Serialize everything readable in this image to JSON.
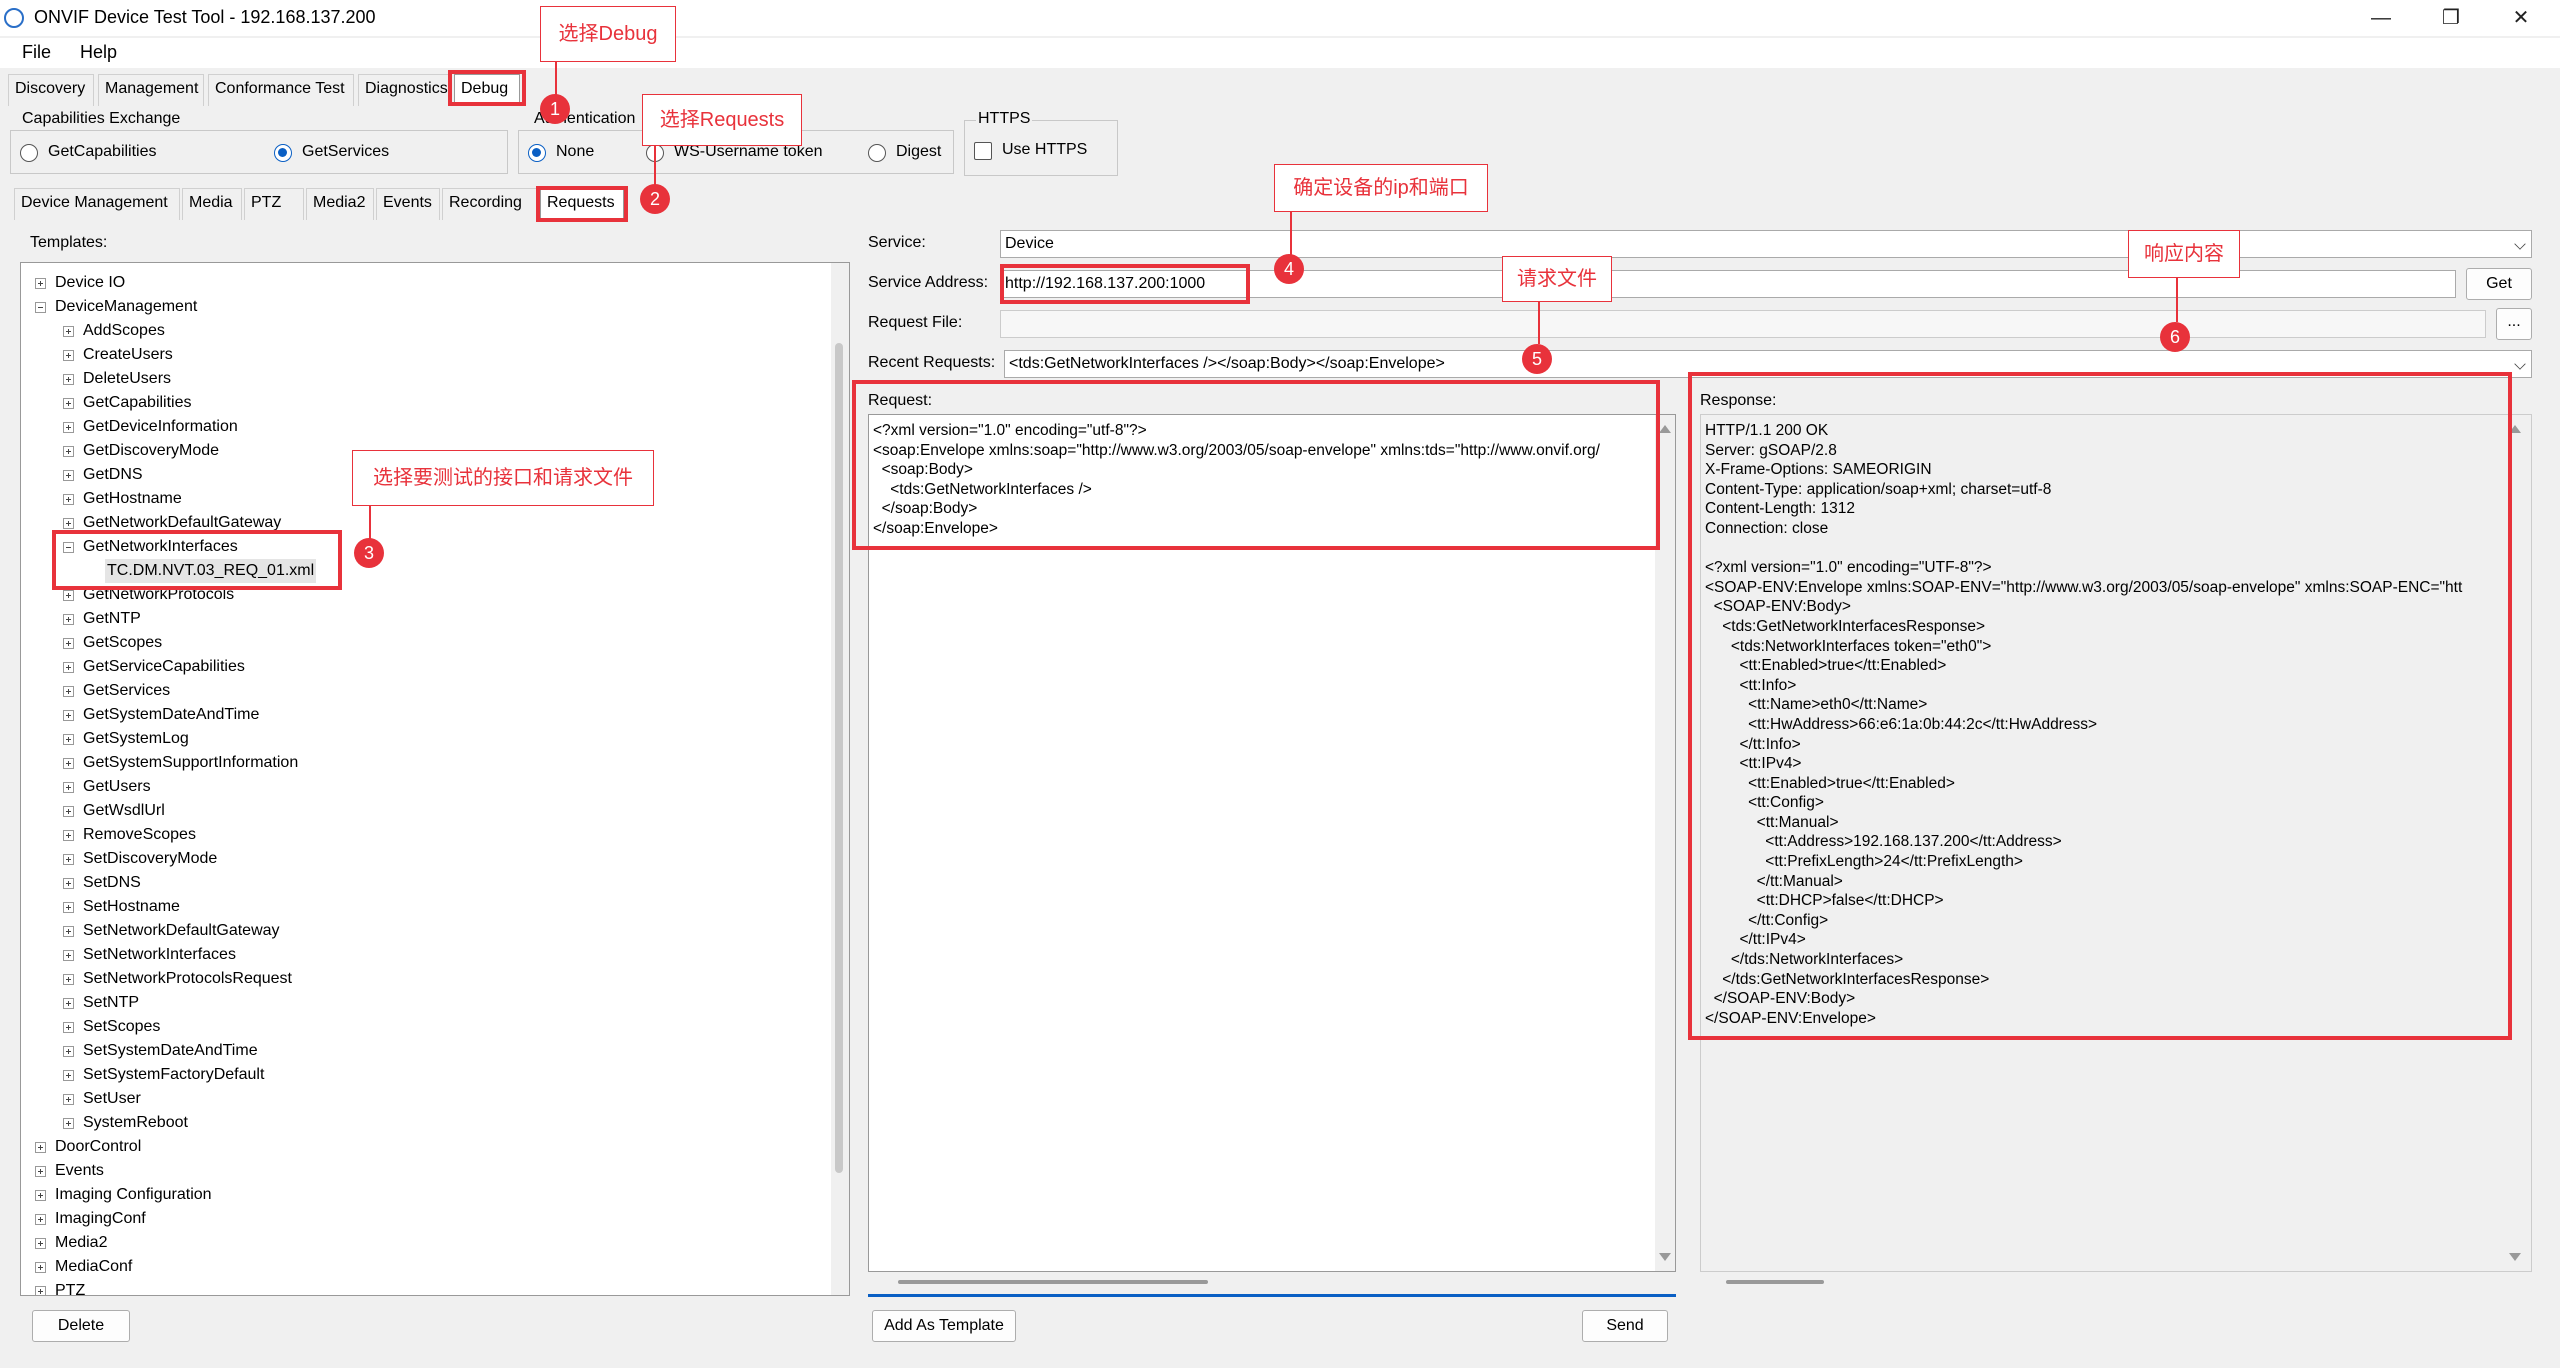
{
  "window": {
    "title": "ONVIF Device Test Tool - 192.168.137.200"
  },
  "menu": {
    "file": "File",
    "help": "Help"
  },
  "main_tabs": [
    "Discovery",
    "Management",
    "Conformance Test",
    "Diagnostics",
    "Debug"
  ],
  "capabilities": {
    "title": "Capabilities Exchange",
    "options": [
      "GetCapabilities",
      "GetServices"
    ],
    "selected": "GetServices"
  },
  "authentication": {
    "title": "Authentication",
    "options": [
      "None",
      "WS-Username token",
      "Digest"
    ],
    "selected": "None"
  },
  "https": {
    "title": "HTTPS",
    "checkbox_label": "Use HTTPS",
    "checked": false
  },
  "sub_tabs": [
    "Device Management",
    "Media",
    "PTZ",
    "Media2",
    "Events",
    "Recording",
    "Requests"
  ],
  "templates": {
    "label": "Templates:",
    "tree": [
      {
        "label": "Device IO",
        "level": 0,
        "state": "closed"
      },
      {
        "label": "DeviceManagement",
        "level": 0,
        "state": "open"
      },
      {
        "label": "AddScopes",
        "level": 1,
        "state": "closed"
      },
      {
        "label": "CreateUsers",
        "level": 1,
        "state": "closed"
      },
      {
        "label": "DeleteUsers",
        "level": 1,
        "state": "closed"
      },
      {
        "label": "GetCapabilities",
        "level": 1,
        "state": "closed"
      },
      {
        "label": "GetDeviceInformation",
        "level": 1,
        "state": "closed"
      },
      {
        "label": "GetDiscoveryMode",
        "level": 1,
        "state": "closed"
      },
      {
        "label": "GetDNS",
        "level": 1,
        "state": "closed"
      },
      {
        "label": "GetHostname",
        "level": 1,
        "state": "closed"
      },
      {
        "label": "GetNetworkDefaultGateway",
        "level": 1,
        "state": "closed"
      },
      {
        "label": "GetNetworkInterfaces",
        "level": 1,
        "state": "open"
      },
      {
        "label": "TC.DM.NVT.03_REQ_01.xml",
        "level": 2,
        "state": "leaf",
        "selected": true
      },
      {
        "label": "GetNetworkProtocols",
        "level": 1,
        "state": "closed"
      },
      {
        "label": "GetNTP",
        "level": 1,
        "state": "closed"
      },
      {
        "label": "GetScopes",
        "level": 1,
        "state": "closed"
      },
      {
        "label": "GetServiceCapabilities",
        "level": 1,
        "state": "closed"
      },
      {
        "label": "GetServices",
        "level": 1,
        "state": "closed"
      },
      {
        "label": "GetSystemDateAndTime",
        "level": 1,
        "state": "closed"
      },
      {
        "label": "GetSystemLog",
        "level": 1,
        "state": "closed"
      },
      {
        "label": "GetSystemSupportInformation",
        "level": 1,
        "state": "closed"
      },
      {
        "label": "GetUsers",
        "level": 1,
        "state": "closed"
      },
      {
        "label": "GetWsdlUrl",
        "level": 1,
        "state": "closed"
      },
      {
        "label": "RemoveScopes",
        "level": 1,
        "state": "closed"
      },
      {
        "label": "SetDiscoveryMode",
        "level": 1,
        "state": "closed"
      },
      {
        "label": "SetDNS",
        "level": 1,
        "state": "closed"
      },
      {
        "label": "SetHostname",
        "level": 1,
        "state": "closed"
      },
      {
        "label": "SetNetworkDefaultGateway",
        "level": 1,
        "state": "closed"
      },
      {
        "label": "SetNetworkInterfaces",
        "level": 1,
        "state": "closed"
      },
      {
        "label": "SetNetworkProtocolsRequest",
        "level": 1,
        "state": "closed"
      },
      {
        "label": "SetNTP",
        "level": 1,
        "state": "closed"
      },
      {
        "label": "SetScopes",
        "level": 1,
        "state": "closed"
      },
      {
        "label": "SetSystemDateAndTime",
        "level": 1,
        "state": "closed"
      },
      {
        "label": "SetSystemFactoryDefault",
        "level": 1,
        "state": "closed"
      },
      {
        "label": "SetUser",
        "level": 1,
        "state": "closed"
      },
      {
        "label": "SystemReboot",
        "level": 1,
        "state": "closed"
      },
      {
        "label": "DoorControl",
        "level": 0,
        "state": "closed"
      },
      {
        "label": "Events",
        "level": 0,
        "state": "closed"
      },
      {
        "label": "Imaging Configuration",
        "level": 0,
        "state": "closed"
      },
      {
        "label": "ImagingConf",
        "level": 0,
        "state": "closed"
      },
      {
        "label": "Media2",
        "level": 0,
        "state": "closed"
      },
      {
        "label": "MediaConf",
        "level": 0,
        "state": "closed"
      },
      {
        "label": "PTZ",
        "level": 0,
        "state": "closed"
      }
    ],
    "delete_button": "Delete"
  },
  "service": {
    "label": "Service:",
    "value": "Device"
  },
  "service_address": {
    "label": "Service Address:",
    "value": "http://192.168.137.200:1000",
    "get_button": "Get"
  },
  "request_file": {
    "label": "Request File:",
    "value": "",
    "browse_button": "..."
  },
  "recent_requests": {
    "label": "Recent Requests:",
    "value": "<tds:GetNetworkInterfaces /></soap:Body></soap:Envelope>"
  },
  "request": {
    "label": "Request:",
    "lines": [
      "<?xml version=\"1.0\" encoding=\"utf-8\"?>",
      "<soap:Envelope xmlns:soap=\"http://www.w3.org/2003/05/soap-envelope\" xmlns:tds=\"http://www.onvif.org/",
      "  <soap:Body>",
      "    <tds:GetNetworkInterfaces />",
      "  </soap:Body>",
      "</soap:Envelope>"
    ]
  },
  "response": {
    "label": "Response:",
    "lines": [
      "HTTP/1.1 200 OK",
      "Server: gSOAP/2.8",
      "X-Frame-Options: SAMEORIGIN",
      "Content-Type: application/soap+xml; charset=utf-8",
      "Content-Length: 1312",
      "Connection: close",
      "",
      "<?xml version=\"1.0\" encoding=\"UTF-8\"?>",
      "<SOAP-ENV:Envelope xmlns:SOAP-ENV=\"http://www.w3.org/2003/05/soap-envelope\" xmlns:SOAP-ENC=\"htt",
      "  <SOAP-ENV:Body>",
      "    <tds:GetNetworkInterfacesResponse>",
      "      <tds:NetworkInterfaces token=\"eth0\">",
      "        <tt:Enabled>true</tt:Enabled>",
      "        <tt:Info>",
      "          <tt:Name>eth0</tt:Name>",
      "          <tt:HwAddress>66:e6:1a:0b:44:2c</tt:HwAddress>",
      "        </tt:Info>",
      "        <tt:IPv4>",
      "          <tt:Enabled>true</tt:Enabled>",
      "          <tt:Config>",
      "            <tt:Manual>",
      "              <tt:Address>192.168.137.200</tt:Address>",
      "              <tt:PrefixLength>24</tt:PrefixLength>",
      "            </tt:Manual>",
      "            <tt:DHCP>false</tt:DHCP>",
      "          </tt:Config>",
      "        </tt:IPv4>",
      "      </tds:NetworkInterfaces>",
      "    </tds:GetNetworkInterfacesResponse>",
      "  </SOAP-ENV:Body>",
      "</SOAP-ENV:Envelope>"
    ]
  },
  "buttons": {
    "add_as_template": "Add As Template",
    "send": "Send"
  },
  "annotations": {
    "callouts": [
      "选择Debug",
      "选择Requests",
      "选择要测试的接口和请求文件",
      "确定设备的ip和端口",
      "请求文件",
      "响应内容"
    ],
    "badges": [
      "1",
      "2",
      "3",
      "4",
      "5",
      "6"
    ],
    "color": "#e8323b"
  }
}
